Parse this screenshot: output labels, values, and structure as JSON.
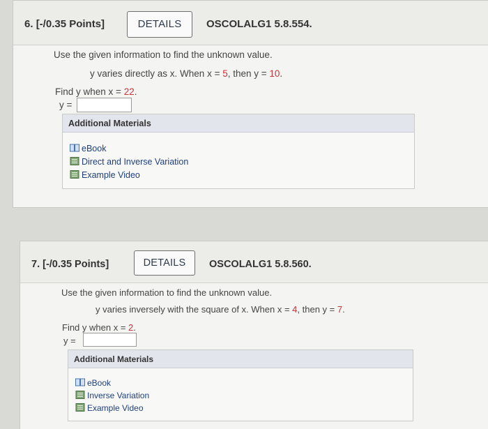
{
  "questions": [
    {
      "number": "6.",
      "points": "[-/0.35 Points]",
      "details_label": "DETAILS",
      "reference": "OSCOLALG1 5.8.554.",
      "instruction": "Use the given information to find the unknown value.",
      "statement_prefix": "y varies directly as x. When ",
      "statement_x_label": "x = ",
      "statement_x_value": "5",
      "statement_then": ", then ",
      "statement_y_label": "y = ",
      "statement_y_value": "10",
      "statement_end": ".",
      "find_prefix": "Find ",
      "find_var": "y",
      "find_when": " when ",
      "find_x_label": "x = ",
      "find_x_value": "22",
      "find_end": ".",
      "answer_label": "y =",
      "answer_value": "",
      "additional_materials_title": "Additional Materials",
      "resources": [
        {
          "label": "eBook",
          "icon": "book-icon"
        },
        {
          "label": "Direct and Inverse Variation",
          "icon": "document-icon"
        },
        {
          "label": "Example Video",
          "icon": "video-icon"
        }
      ]
    },
    {
      "number": "7.",
      "points": "[-/0.35 Points]",
      "details_label": "DETAILS",
      "reference": "OSCOLALG1 5.8.560.",
      "instruction": "Use the given information to find the unknown value.",
      "statement_prefix": "y varies inversely with the square of x. When ",
      "statement_x_label": "x = ",
      "statement_x_value": "4",
      "statement_then": ", then ",
      "statement_y_label": "y = ",
      "statement_y_value": "7",
      "statement_end": ".",
      "find_prefix": "Find ",
      "find_var": "y",
      "find_when": " when ",
      "find_x_label": "x = ",
      "find_x_value": "2",
      "find_end": ".",
      "answer_label": "y =",
      "answer_value": "",
      "additional_materials_title": "Additional Materials",
      "resources": [
        {
          "label": "eBook",
          "icon": "book-icon"
        },
        {
          "label": "Inverse Variation",
          "icon": "document-icon"
        },
        {
          "label": "Example Video",
          "icon": "video-icon"
        }
      ]
    }
  ],
  "colors": {
    "highlight_value": "#c8323a",
    "link": "#1f3f7a",
    "materials_header": "#e3e5ec"
  }
}
